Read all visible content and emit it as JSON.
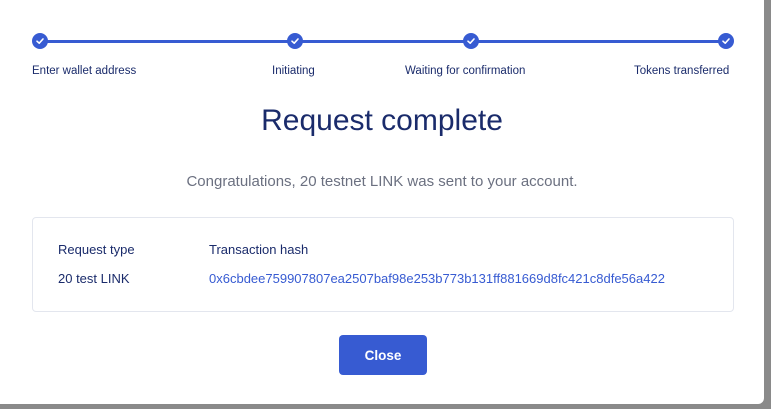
{
  "stepper": {
    "steps": [
      {
        "label": "Enter wallet address",
        "status": "complete"
      },
      {
        "label": "Initiating",
        "status": "complete"
      },
      {
        "label": "Waiting for confirmation",
        "status": "complete"
      },
      {
        "label": "Tokens transferred",
        "status": "complete"
      }
    ],
    "step_icon": "check-icon"
  },
  "title": "Request complete",
  "subtitle": "Congratulations, 20 testnet LINK was sent to your account.",
  "details": {
    "request_type_label": "Request type",
    "request_type_value": "20 test LINK",
    "tx_hash_label": "Transaction hash",
    "tx_hash_value": "0x6cbdee759907807ea2507baf98e253b773b131ff881669d8fc421c8dfe56a422"
  },
  "close_label": "Close",
  "colors": {
    "accent": "#375bd2",
    "heading": "#1a2b6b",
    "muted": "#6b7080"
  }
}
